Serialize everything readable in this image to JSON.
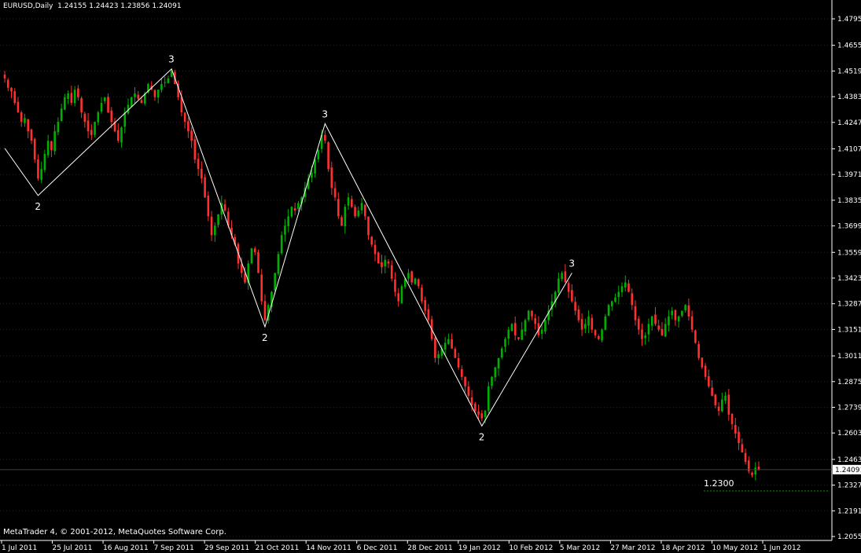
{
  "window": {
    "symbol_label": "EURUSD,Daily",
    "ohlc": "1.24155 1.24423 1.23856 1.24091",
    "copyright": "MetaTrader 4, © 2001-2012, MetaQuotes Software Corp."
  },
  "colors": {
    "background": "#000000",
    "axis": "#ffffff",
    "grid": "#1f2a1f",
    "bull": "#00b000",
    "bear": "#ff3030",
    "zigzag": "#ffffff",
    "level_line": "#00a000"
  },
  "chart_data": {
    "type": "line",
    "xlabel": "",
    "ylabel": "",
    "grid": true,
    "ylim": [
      1.2055,
      1.4865
    ],
    "y_ticks": [
      "1.47950",
      "1.46550",
      "1.45190",
      "1.43830",
      "1.42470",
      "1.41070",
      "1.39710",
      "1.38350",
      "1.36990",
      "1.35590",
      "1.34230",
      "1.32870",
      "1.31510",
      "1.30110",
      "1.28750",
      "1.27390",
      "1.26030",
      "1.24630",
      "1.23270",
      "1.21910",
      "1.20550"
    ],
    "x_ticks": [
      "1 Jul 2011",
      "25 Jul 2011",
      "16 Aug 2011",
      "7 Sep 2011",
      "29 Sep 2011",
      "21 Oct 2011",
      "14 Nov 2011",
      "6 Dec 2011",
      "28 Dec 2011",
      "19 Jan 2012",
      "10 Feb 2012",
      "5 Mar 2012",
      "27 Mar 2012",
      "18 Apr 2012",
      "10 May 2012",
      "1 Jun 2012"
    ],
    "current_price": "1.24091",
    "level": {
      "label": "1.2300",
      "value": 1.2296
    },
    "series": [
      {
        "values": [
          1.448,
          1.443,
          1.441,
          1.435,
          1.43,
          1.425,
          1.427,
          1.42,
          1.415,
          1.405,
          1.395,
          1.4,
          1.408,
          1.415,
          1.41,
          1.42,
          1.425,
          1.432,
          1.438,
          1.44,
          1.435,
          1.442,
          1.438,
          1.43,
          1.425,
          1.42,
          1.418,
          1.425,
          1.43,
          1.435,
          1.438,
          1.43,
          1.425,
          1.42,
          1.415,
          1.422,
          1.43,
          1.434,
          1.438,
          1.44,
          1.437,
          1.435,
          1.44,
          1.445,
          1.442,
          1.438,
          1.442,
          1.445,
          1.446,
          1.448,
          1.452,
          1.445,
          1.438,
          1.43,
          1.425,
          1.42,
          1.415,
          1.405,
          1.4,
          1.395,
          1.385,
          1.375,
          1.365,
          1.37,
          1.376,
          1.382,
          1.378,
          1.37,
          1.365,
          1.36,
          1.35,
          1.345,
          1.34,
          1.35,
          1.358,
          1.356,
          1.345,
          1.33,
          1.32,
          1.328,
          1.335,
          1.345,
          1.355,
          1.365,
          1.37,
          1.375,
          1.38,
          1.378,
          1.382,
          1.385,
          1.39,
          1.395,
          1.398,
          1.405,
          1.41,
          1.418,
          1.415,
          1.4,
          1.39,
          1.385,
          1.375,
          1.37,
          1.38,
          1.385,
          1.38,
          1.375,
          1.378,
          1.382,
          1.375,
          1.365,
          1.36,
          1.355,
          1.35,
          1.348,
          1.352,
          1.35,
          1.342,
          1.335,
          1.33,
          1.338,
          1.342,
          1.345,
          1.34,
          1.342,
          1.338,
          1.33,
          1.325,
          1.32,
          1.31,
          1.3,
          1.302,
          1.305,
          1.308,
          1.31,
          1.305,
          1.3,
          1.295,
          1.29,
          1.285,
          1.28,
          1.275,
          1.272,
          1.27,
          1.268,
          1.272,
          1.285,
          1.29,
          1.295,
          1.3,
          1.305,
          1.31,
          1.315,
          1.318,
          1.312,
          1.31,
          1.315,
          1.32,
          1.325,
          1.322,
          1.318,
          1.312,
          1.315,
          1.32,
          1.325,
          1.33,
          1.335,
          1.342,
          1.345,
          1.34,
          1.335,
          1.33,
          1.325,
          1.32,
          1.315,
          1.318,
          1.322,
          1.315,
          1.312,
          1.31,
          1.315,
          1.322,
          1.328,
          1.33,
          1.332,
          1.335,
          1.338,
          1.34,
          1.335,
          1.328,
          1.32,
          1.315,
          1.31,
          1.312,
          1.318,
          1.322,
          1.318,
          1.315,
          1.312,
          1.318,
          1.322,
          1.325,
          1.32,
          1.322,
          1.325,
          1.328,
          1.322,
          1.315,
          1.308,
          1.3,
          1.295,
          1.29,
          1.285,
          1.28,
          1.275,
          1.272,
          1.278,
          1.28,
          1.27,
          1.265,
          1.26,
          1.255,
          1.25,
          1.245,
          1.24,
          1.238,
          1.242,
          1.2409
        ]
      }
    ],
    "zigzag": [
      {
        "index": 0,
        "value": 1.411,
        "label": ""
      },
      {
        "index": 10,
        "value": 1.386,
        "label": "2"
      },
      {
        "index": 50,
        "value": 1.453,
        "label": "3"
      },
      {
        "index": 78,
        "value": 1.3165,
        "label": "2"
      },
      {
        "index": 96,
        "value": 1.424,
        "label": "3"
      },
      {
        "index": 143,
        "value": 1.264,
        "label": "2"
      },
      {
        "index": 170,
        "value": 1.345,
        "label": "3"
      }
    ]
  }
}
